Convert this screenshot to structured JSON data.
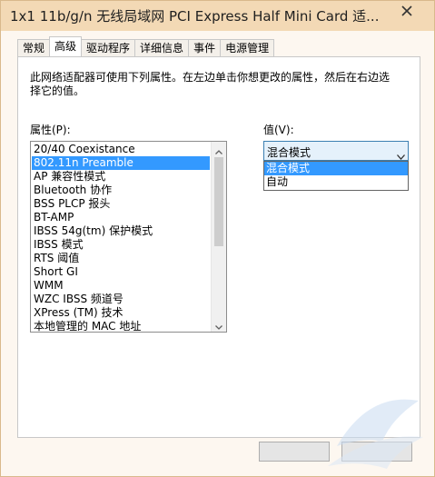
{
  "window": {
    "title": "1x1 11b/g/n 无线局域网 PCI Express Half Mini Card 适..."
  },
  "tabs": [
    {
      "label": "常规",
      "active": false
    },
    {
      "label": "高级",
      "active": true
    },
    {
      "label": "驱动程序",
      "active": false
    },
    {
      "label": "详细信息",
      "active": false
    },
    {
      "label": "事件",
      "active": false
    },
    {
      "label": "电源管理",
      "active": false
    }
  ],
  "advanced": {
    "description": "此网络适配器可使用下列属性。在左边单击你想更改的属性，然后在右边选择它的值。",
    "property_label": "属性(P):",
    "value_label": "值(V):",
    "properties": [
      "20/40 Coexistance",
      "802.11n Preamble",
      "AP 兼容性模式",
      "Bluetooth 协作",
      "BSS PLCP 报头",
      "BT-AMP",
      "IBSS 54g(tm) 保护模式",
      "IBSS 模式",
      "RTS 阈值",
      "Short GI",
      "WMM",
      "WZC IBSS 频道号",
      "XPress (TM) 技术",
      "本地管理的 MAC 地址"
    ],
    "selected_property": "802.11n Preamble",
    "value_selected": "混合模式",
    "value_options": [
      "混合模式",
      "自动"
    ]
  },
  "icons": {
    "close": "close-icon",
    "scroll_up": "chevron-up-icon",
    "scroll_down": "chevron-down-icon",
    "combo_arrow": "chevron-down-icon"
  },
  "colors": {
    "selection": "#3399ff",
    "titlebar": "#f3d9b5",
    "window_bg": "#fdf7f0"
  }
}
